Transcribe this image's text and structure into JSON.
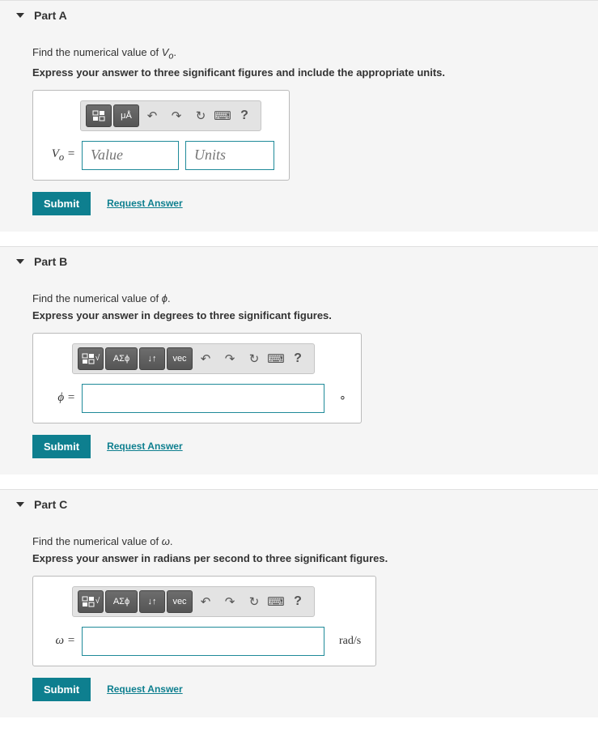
{
  "parts": [
    {
      "title": "Part A",
      "prompt_prefix": "Find the numerical value of ",
      "prompt_var": "V",
      "prompt_sub": "o",
      "prompt_suffix": ".",
      "instruction": "Express your answer to three significant figures and include the appropriate units.",
      "var_label_html": "V<sub>o</sub> =",
      "toolbar_type": "units",
      "value_placeholder": "Value",
      "units_placeholder": "Units",
      "unit_suffix": "",
      "submit": "Submit",
      "request": "Request Answer"
    },
    {
      "title": "Part B",
      "prompt_prefix": "Find the numerical value of ",
      "prompt_var": "ϕ",
      "prompt_sub": "",
      "prompt_suffix": ".",
      "instruction": "Express your answer in degrees to three significant figures.",
      "var_label_html": "ϕ =",
      "toolbar_type": "full",
      "value_placeholder": "",
      "unit_suffix": "∘",
      "submit": "Submit",
      "request": "Request Answer"
    },
    {
      "title": "Part C",
      "prompt_prefix": "Find the numerical value of ",
      "prompt_var": "ω",
      "prompt_sub": "",
      "prompt_suffix": ".",
      "instruction": "Express your answer in radians per second to three significant figures.",
      "var_label_html": "ω =",
      "toolbar_type": "full",
      "value_placeholder": "",
      "unit_suffix": "rad/s",
      "submit": "Submit",
      "request": "Request Answer"
    }
  ],
  "tool": {
    "templates": "▭",
    "sqrt": "x√☐",
    "greek": "ΑΣϕ",
    "subscript": "↓↑",
    "vec": "vec",
    "units_btn": "μÅ",
    "undo": "↶",
    "redo": "↷",
    "reset": "↻",
    "keyboard": "⌨",
    "help": "?"
  }
}
